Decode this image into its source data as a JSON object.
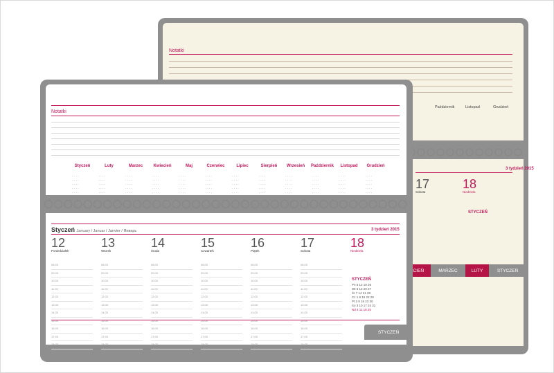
{
  "back": {
    "notes_title": "Notatki",
    "months": [
      "Październik",
      "Listopad",
      "Grudzień"
    ],
    "tabs": [
      "KWIECIEŃ",
      "MARZEC",
      "LUTY",
      "STYCZEŃ"
    ],
    "year": "3 tydzień 2015",
    "days": [
      {
        "num": "17",
        "name": "Sobota"
      },
      {
        "num": "18",
        "name": "Niedziela"
      }
    ],
    "mini_title": "STYCZEŃ"
  },
  "front": {
    "notes_title": "Notatki",
    "months": [
      "Styczeń",
      "Luty",
      "Marzec",
      "Kwiecień",
      "Maj",
      "Czerwiec",
      "Lipiec",
      "Sierpień",
      "Wrzesień",
      "Październik",
      "Listopad",
      "Grudzień"
    ],
    "week_title": "Styczeń",
    "week_sub": "January / Januar / Janvier / Январь",
    "year": "3 tydzień 2015",
    "days": [
      {
        "num": "12",
        "name": "Poniedziałek"
      },
      {
        "num": "13",
        "name": "Wtorek"
      },
      {
        "num": "14",
        "name": "Środa"
      },
      {
        "num": "15",
        "name": "Czwartek"
      },
      {
        "num": "16",
        "name": "Piątek"
      },
      {
        "num": "17",
        "name": "Sobota"
      },
      {
        "num": "18",
        "name": "Niedziela"
      }
    ],
    "hours": [
      "08.00",
      "09.00",
      "10.00",
      "11.00",
      "12.00",
      "13.00",
      "14.00",
      "15.00",
      "16.00",
      "17.00",
      "18.00"
    ],
    "mini_title": "STYCZEŃ",
    "tab_label": "STYCZEŃ"
  },
  "colors": {
    "accent": "#c2185b",
    "cover": "#8f8f8f",
    "paper_back": "#f6f2e4",
    "paper_front": "#ffffff"
  }
}
